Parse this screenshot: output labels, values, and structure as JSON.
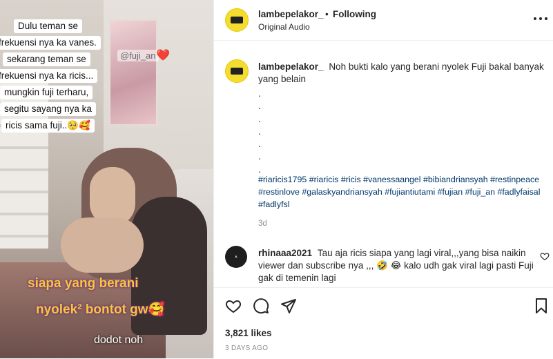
{
  "media": {
    "caption_lines": [
      "Dulu teman se",
      "frekuensi nya ka vanes.",
      "sekarang teman se",
      "frekuensi nya ka ricis...",
      "mungkin fuji terharu,",
      "segitu sayang nya ka",
      "ricis sama fuji..🥺🥰"
    ],
    "tag": "@fuji_an",
    "heart": "❤️",
    "overlay_line1": "siapa yang berani",
    "overlay_line2": "nyolek² bontot gw🥰",
    "overlay_line3": "dodot noh"
  },
  "header": {
    "username": "lambepelakor_",
    "separator": "•",
    "follow_status": "Following",
    "audio": "Original Audio",
    "more_icon": "more-options-icon",
    "avatar_icon": "profile-avatar"
  },
  "caption": {
    "username": "lambepelakor_",
    "text": "Noh bukti kalo yang berani nyolek Fuji bakal banyak yang belain",
    "dots": [
      ".",
      ".",
      ".",
      ".",
      ".",
      ".",
      "."
    ],
    "hashtags": "#riaricis1795 #riaricis #ricis #vanessaangel #bibiandriansyah #restinpeace #restinlove #galaskyandriansyah #fujiantiutami #fujian #fuji_an #fadlyfaisal #fadlyfsl",
    "time": "3d"
  },
  "comment": {
    "username": "rhinaaa2021",
    "text": "Tau aja ricis siapa yang lagi viral,,,yang bisa naikin viewer dan subscribe nya ,,, 🤣 😂  kalo udh gak viral lagi pasti Fuji gak di temenin lagi",
    "like_icon": "heart-outline-icon"
  },
  "actions": {
    "like_icon": "heart-icon",
    "comment_icon": "comment-icon",
    "share_icon": "share-icon",
    "save_icon": "bookmark-icon",
    "likes": "3,821 likes",
    "posted": "3 DAYS AGO"
  },
  "colors": {
    "link": "#00376b",
    "muted": "#8e8e8e",
    "avatar_bg": "#f5dd30"
  }
}
